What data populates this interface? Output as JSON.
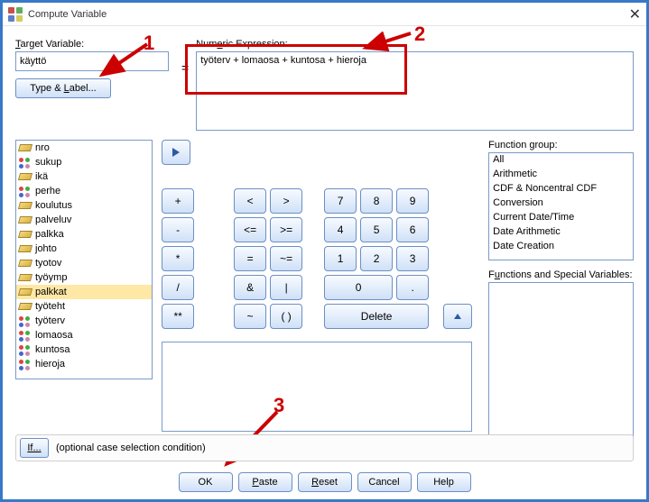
{
  "window": {
    "title": "Compute Variable",
    "close": "✕"
  },
  "labels": {
    "target_variable": "Target Variable:",
    "numeric_expression": "Numeric Expression:",
    "type_label": "Type & Label...",
    "equals": "=",
    "function_group": "Function group:",
    "functions_special": "Functions and Special Variables:",
    "if_button": "If...",
    "if_desc": "(optional case selection condition)"
  },
  "inputs": {
    "target_variable_value": "käyttö",
    "expression_value": "työterv + lomaosa + kuntosa + hieroja"
  },
  "variables": [
    {
      "name": "nro",
      "kind": "scale"
    },
    {
      "name": "sukup",
      "kind": "nom"
    },
    {
      "name": "ikä",
      "kind": "scale"
    },
    {
      "name": "perhe",
      "kind": "nom"
    },
    {
      "name": "koulutus",
      "kind": "scale"
    },
    {
      "name": "palveluv",
      "kind": "scale"
    },
    {
      "name": "palkka",
      "kind": "scale"
    },
    {
      "name": "johto",
      "kind": "scale"
    },
    {
      "name": "tyotov",
      "kind": "scale"
    },
    {
      "name": "työymp",
      "kind": "scale"
    },
    {
      "name": "palkkat",
      "kind": "scale",
      "selected": true
    },
    {
      "name": "työteht",
      "kind": "scale"
    },
    {
      "name": "työterv",
      "kind": "nom"
    },
    {
      "name": "lomaosa",
      "kind": "nom"
    },
    {
      "name": "kuntosa",
      "kind": "nom"
    },
    {
      "name": "hieroja",
      "kind": "nom"
    }
  ],
  "keypad": {
    "r1": [
      "+",
      "<",
      ">",
      "7",
      "8",
      "9"
    ],
    "r2": [
      "-",
      "<=",
      ">=",
      "4",
      "5",
      "6"
    ],
    "r3": [
      "*",
      "=",
      "~=",
      "1",
      "2",
      "3"
    ],
    "r4": [
      "/",
      "&",
      "|",
      "0",
      "."
    ],
    "r5": [
      "**",
      "~",
      "( )",
      "Delete"
    ]
  },
  "function_groups": [
    "All",
    "Arithmetic",
    "CDF & Noncentral CDF",
    "Conversion",
    "Current Date/Time",
    "Date Arithmetic",
    "Date Creation"
  ],
  "buttons": {
    "ok": "OK",
    "paste": "Paste",
    "reset": "Reset",
    "cancel": "Cancel",
    "help": "Help"
  },
  "callouts": {
    "n1": "1",
    "n2": "2",
    "n3": "3"
  }
}
